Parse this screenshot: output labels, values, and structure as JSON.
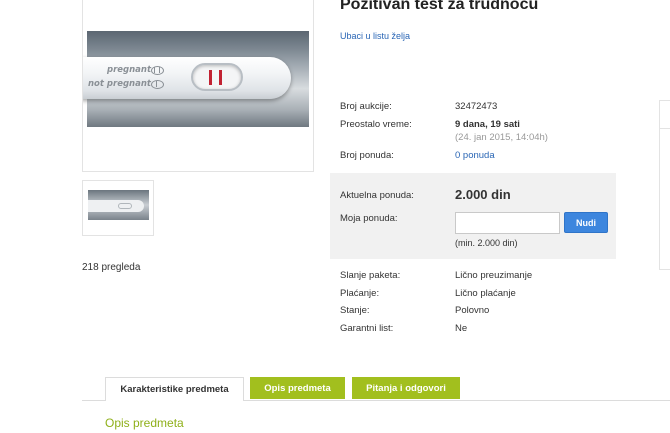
{
  "product": {
    "title": "Pozitivan test za trudnocu",
    "wishlist_link": "Ubaci u listu želja",
    "image_labels": [
      "pregnant",
      "not pregnant"
    ],
    "views": "218 pregleda"
  },
  "auction": {
    "number_label": "Broj aukcije:",
    "number_value": "32472473",
    "remaining_label": "Preostalo vreme:",
    "remaining_value": "9 dana, 19 sati",
    "end_date": "(24. jan 2015, 14:04h)",
    "bids_label": "Broj ponuda:",
    "bids_value": "0 ponuda"
  },
  "bidding": {
    "current_label": "Aktuelna ponuda:",
    "current_value": "2.000 din",
    "my_bid_label": "Moja ponuda:",
    "my_bid_value": "",
    "button_label": "Nudi",
    "min_note": "(min. 2.000 din)"
  },
  "details": [
    {
      "label": "Slanje paketa:",
      "value": "Lično preuzimanje"
    },
    {
      "label": "Plaćanje:",
      "value": "Lično plaćanje"
    },
    {
      "label": "Stanje:",
      "value": "Polovno"
    },
    {
      "label": "Garantni list:",
      "value": "Ne"
    }
  ],
  "tabs": [
    {
      "label": "Karakteristike predmeta",
      "active": true
    },
    {
      "label": "Opis predmeta",
      "active": false
    },
    {
      "label": "Pitanja i odgovori",
      "active": false
    }
  ],
  "section_title": "Opis predmeta",
  "colors": {
    "accent_green": "#a2bf1e",
    "link_blue": "#2a66b5",
    "button_blue": "#3d86de",
    "test_line_red": "#c22232"
  }
}
